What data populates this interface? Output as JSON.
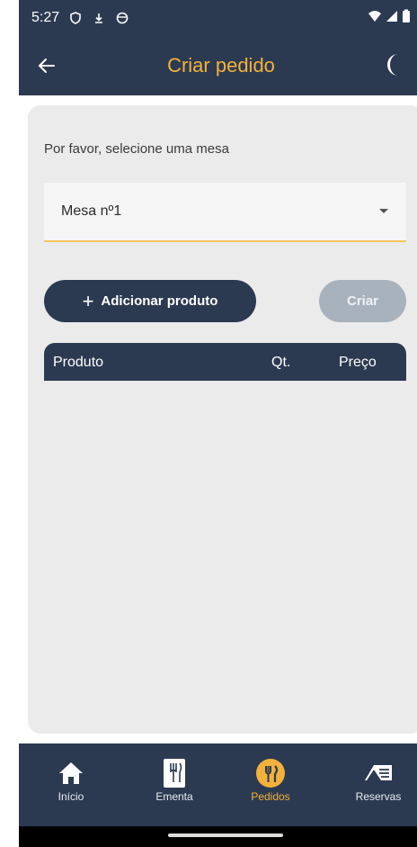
{
  "status": {
    "time": "5:27"
  },
  "app_bar": {
    "title": "Criar pedido"
  },
  "form": {
    "prompt": "Por favor, selecione uma mesa",
    "table_select_value": "Mesa nº1",
    "add_product_label": "Adicionar produto",
    "create_label": "Criar"
  },
  "table": {
    "columns": [
      "Produto",
      "Qt.",
      "Preço"
    ]
  },
  "nav": {
    "items": [
      {
        "label": "Início",
        "icon": "home-icon"
      },
      {
        "label": "Ementa",
        "icon": "menu-book-icon"
      },
      {
        "label": "Pedidos",
        "icon": "restaurant-icon",
        "active": true
      },
      {
        "label": "Reservas",
        "icon": "reservation-ticket-icon"
      }
    ]
  },
  "colors": {
    "primary": "#2c3a51",
    "accent": "#f3b13b",
    "card": "#ebebeb",
    "disabled": "#a8b2bd"
  }
}
